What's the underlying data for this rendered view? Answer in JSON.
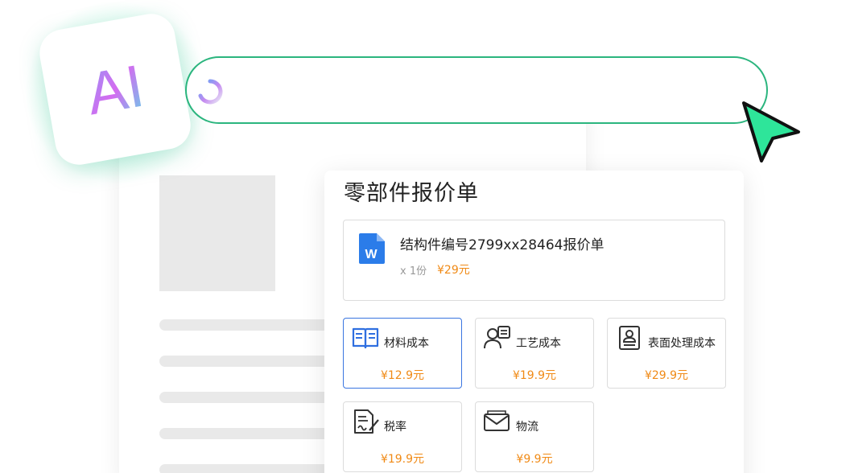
{
  "badge": {
    "text": "AI",
    "glow_color": "#48e2aa",
    "gradient": [
      "#d56bf0",
      "#8a9cf5",
      "#5ad9e8"
    ]
  },
  "prompt": {
    "value": "",
    "border_color": "#2bb57e",
    "status_icon": "loading-spinner-icon"
  },
  "cursor": {
    "icon": "pointer-arrow-icon",
    "color": "#2ee59a"
  },
  "quote": {
    "title": "零部件报价单",
    "file": {
      "icon": "word-document-icon",
      "icon_color": "#2b7ce9",
      "name": "结构件编号2799xx28464报价单",
      "qty": "x 1份",
      "price": "¥29元"
    },
    "costs": [
      {
        "label": "材料成本",
        "price": "¥12.9元",
        "icon": "open-book-icon",
        "selected": true
      },
      {
        "label": "工艺成本",
        "price": "¥19.9元",
        "icon": "engineer-icon",
        "selected": false
      },
      {
        "label": "表面处理成本",
        "price": "¥29.9元",
        "icon": "badge-card-icon",
        "selected": false
      },
      {
        "label": "税率",
        "price": "¥19.9元",
        "icon": "signed-document-icon",
        "selected": false
      },
      {
        "label": "物流",
        "price": "¥9.9元",
        "icon": "envelope-icon",
        "selected": false
      }
    ],
    "accent_color": "#3a75e0",
    "price_color": "#f08a16"
  }
}
